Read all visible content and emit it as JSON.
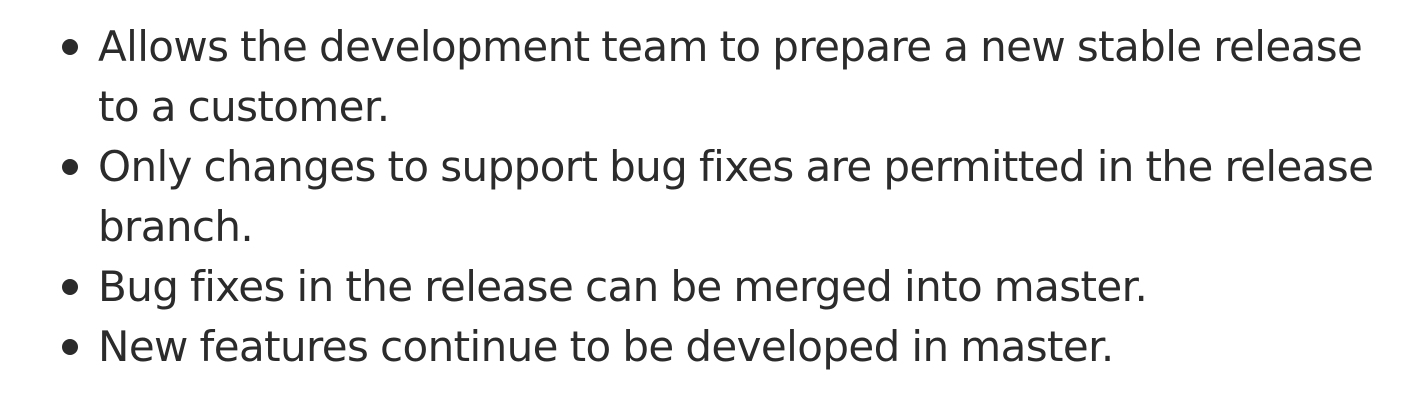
{
  "bullets": [
    {
      "text": "Allows the development team to prepare a new stable release to a customer."
    },
    {
      "text": "Only changes to support bug fixes are permitted in the release branch."
    },
    {
      "text": "Bug fixes in the release can be merged into master."
    },
    {
      "text": "New features continue to be developed in master."
    }
  ]
}
